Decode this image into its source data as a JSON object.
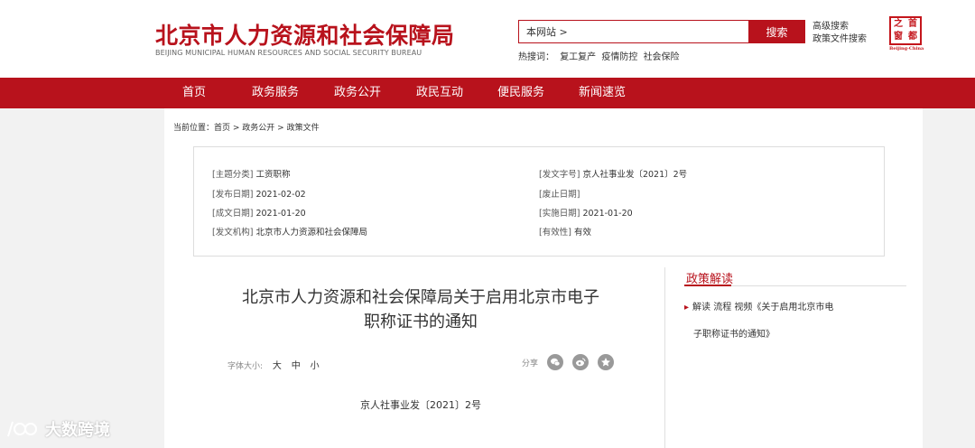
{
  "header": {
    "title_cn": "北京市人力资源和社会保障局",
    "title_en": "BEIJING MUNICIPAL HUMAN RESOURCES AND SOCIAL SECURITY BUREAU",
    "search": {
      "value": "本网站 >",
      "button_label": "搜索"
    },
    "advanced_search": "高级搜索",
    "policy_search": "政策文件搜索",
    "hot_words_label": "热搜词：",
    "hot_words": [
      "复工复产",
      "疫情防控",
      "社会保险"
    ],
    "seal": {
      "chars": [
        "首",
        "之",
        "都",
        "窗"
      ],
      "caption": "Beijing·China"
    }
  },
  "nav": {
    "items": [
      "首页",
      "政务服务",
      "政务公开",
      "政民互动",
      "便民服务",
      "新闻速览"
    ]
  },
  "breadcrumb": {
    "prefix": "当前位置：",
    "items": [
      "首页",
      "政务公开",
      "政策文件"
    ],
    "separator": " > "
  },
  "meta": {
    "category": {
      "label": "[主题分类]",
      "value": "工资职称"
    },
    "doc_no": {
      "label": "[发文字号]",
      "value": "京人社事业发〔2021〕2号"
    },
    "publish_date": {
      "label": "[发布日期]",
      "value": "2021-02-02"
    },
    "expiry_date": {
      "label": "[废止日期]",
      "value": ""
    },
    "written_date": {
      "label": "[成文日期]",
      "value": "2021-01-20"
    },
    "effective_date": {
      "label": "[实施日期]",
      "value": "2021-01-20"
    },
    "issuer": {
      "label": "[发文机构]",
      "value": "北京市人力资源和社会保障局"
    },
    "validity": {
      "label": "[有效性]",
      "value": "有效"
    }
  },
  "article": {
    "title_line1": "北京市人力资源和社会保障局关于启用北京市电子",
    "title_line2": "职称证书的通知",
    "font_size_label": "字体大小:",
    "font_sizes": [
      "大",
      "中",
      "小"
    ],
    "share_label": "分享",
    "doc_no": "京人社事业发〔2021〕2号"
  },
  "sidebar": {
    "title": "政策解读",
    "link_line1": "解读 流程 视频《关于启用北京市电",
    "link_line2": "子职称证书的通知》"
  },
  "watermark": {
    "text": "大数跨境"
  },
  "colors": {
    "brand": "#b8121c",
    "background": "#f2f2f2"
  }
}
